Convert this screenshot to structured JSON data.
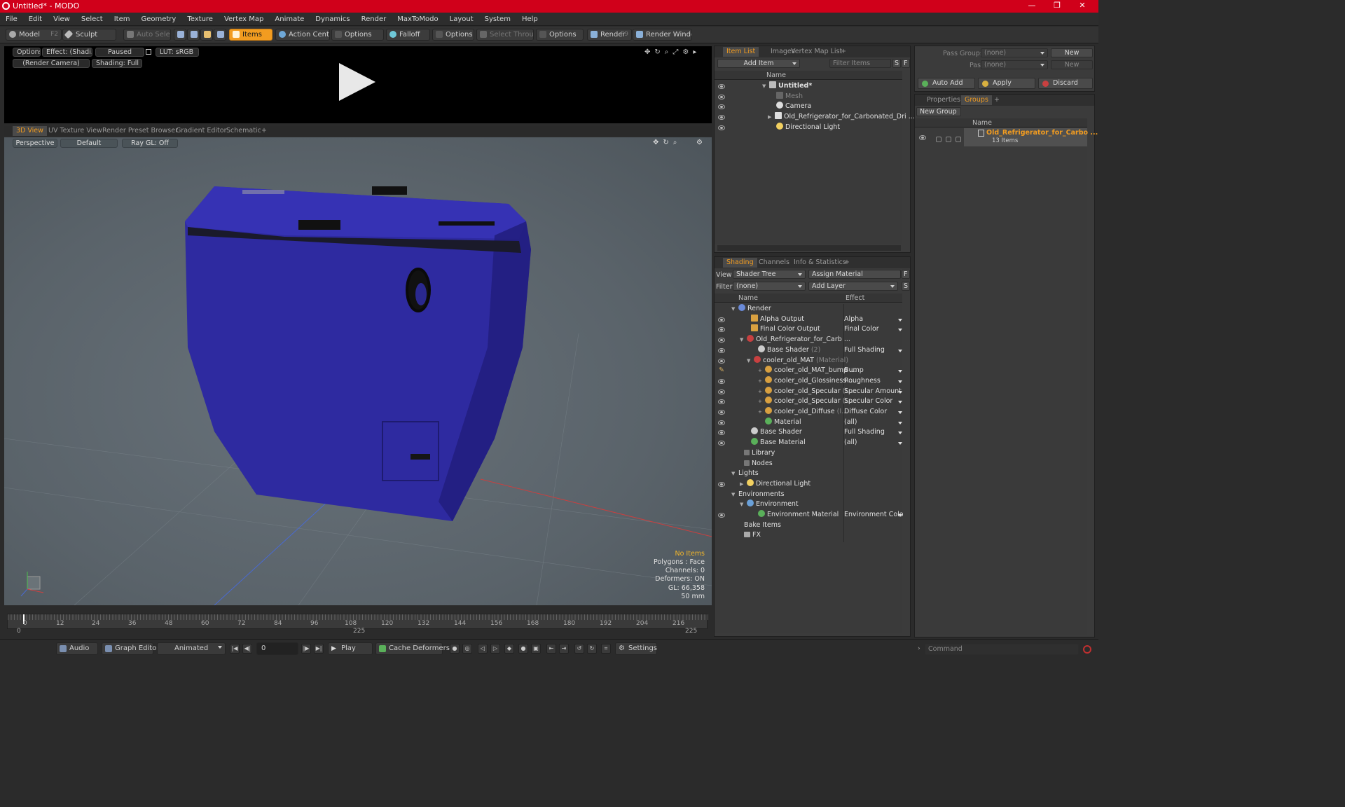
{
  "window": {
    "title": "Untitled* - MODO",
    "controls": [
      "—",
      "❐",
      "⧉",
      "✕"
    ]
  },
  "menu": [
    "File",
    "Edit",
    "View",
    "Select",
    "Item",
    "Geometry",
    "Texture",
    "Vertex Map",
    "Animate",
    "Dynamics",
    "Render",
    "MaxToModo",
    "Layout",
    "System",
    "Help"
  ],
  "toolbar": {
    "model": "Model",
    "model_key": "F2",
    "sculpt": "Sculpt",
    "auto_select": "Auto Select",
    "items": "Items",
    "action_center": "Action Center",
    "options1": "Options",
    "falloff": "Falloff",
    "options2": "Options",
    "select_through": "Select Through",
    "options3": "Options",
    "render": "Render",
    "render_key": "F9",
    "render_window": "Render Window"
  },
  "render_preview": {
    "options": "Options",
    "effect": "Effect: (Shadi...",
    "paused": "Paused",
    "lut": "LUT: sRGB",
    "camera": "(Render Camera)",
    "shading": "Shading: Full"
  },
  "viewport_tabs": [
    "3D View",
    "UV Texture View",
    "Render Preset Browser",
    "Gradient Editor",
    "Schematic",
    "+"
  ],
  "viewport": {
    "perspective": "Perspective",
    "default": "Default",
    "raygl": "Ray GL: Off",
    "hud": {
      "no_items": "No Items",
      "polygons": "Polygons : Face",
      "channels": "Channels: 0",
      "deformers": "Deformers: ON",
      "gl": "GL: 66,358",
      "focal": "50 mm"
    }
  },
  "timeline": {
    "ticks": [
      "0",
      "12",
      "24",
      "36",
      "48",
      "60",
      "72",
      "84",
      "96",
      "108",
      "120",
      "132",
      "144",
      "156",
      "168",
      "180",
      "192",
      "204",
      "216"
    ],
    "start": "0",
    "mid": "225",
    "end": "225"
  },
  "bottombar": {
    "audio": "Audio",
    "graph_editor": "Graph Editor",
    "animated": "Animated",
    "frame": "0",
    "play": "Play",
    "cache_deformers": "Cache Deformers",
    "settings": "Settings",
    "command_placeholder": "Command"
  },
  "item_list": {
    "tabs": [
      "Item List",
      "Images",
      "Vertex Map List",
      "+"
    ],
    "add_item": "Add Item",
    "filter_items": "Filter Items",
    "s": "S",
    "f": "F",
    "col_name": "Name",
    "rows": [
      {
        "label": "Untitled*",
        "depth": 0
      },
      {
        "label": "Mesh",
        "depth": 1
      },
      {
        "label": "Camera",
        "depth": 1
      },
      {
        "label": "Old_Refrigerator_for_Carbonated_Dri ...",
        "depth": 1
      },
      {
        "label": "Directional Light",
        "depth": 1
      }
    ]
  },
  "shading": {
    "tabs": [
      "Shading",
      "Channels",
      "Info & Statistics",
      "+"
    ],
    "view_label": "View",
    "view_value": "Shader Tree",
    "assign_material": "Assign Material",
    "filter_label": "Filter",
    "filter_value": "(none)",
    "add_layer": "Add Layer",
    "f": "F",
    "s": "S",
    "col_name": "Name",
    "col_effect": "Effect",
    "rows": [
      {
        "name": "Render",
        "effect": ""
      },
      {
        "name": "Alpha Output",
        "effect": "Alpha"
      },
      {
        "name": "Final Color Output",
        "effect": "Final Color"
      },
      {
        "name": "Old_Refrigerator_for_Carb ...",
        "effect": ""
      },
      {
        "name": "Base Shader",
        "suffix": "(2)",
        "effect": "Full Shading"
      },
      {
        "name": "cooler_old_MAT",
        "suffix": "(Material)",
        "effect": ""
      },
      {
        "name": "cooler_old_MAT_bump ...",
        "effect": "Bump"
      },
      {
        "name": "cooler_old_Glossiness ...",
        "effect": "Roughness"
      },
      {
        "name": "cooler_old_Specular",
        "suffix": "(I...",
        "effect": "Specular Amount"
      },
      {
        "name": "cooler_old_Specular",
        "suffix": "(I...",
        "effect": "Specular Color"
      },
      {
        "name": "cooler_old_Diffuse",
        "suffix": "(I...",
        "effect": "Diffuse Color"
      },
      {
        "name": "Material",
        "effect": "(all)"
      },
      {
        "name": "Base Shader",
        "effect": "Full Shading"
      },
      {
        "name": "Base Material",
        "effect": "(all)"
      },
      {
        "name": "Library",
        "effect": ""
      },
      {
        "name": "Nodes",
        "effect": ""
      },
      {
        "name": "Lights",
        "effect": ""
      },
      {
        "name": "Directional Light",
        "effect": ""
      },
      {
        "name": "Environments",
        "effect": ""
      },
      {
        "name": "Environment",
        "effect": ""
      },
      {
        "name": "Environment Material",
        "effect": "Environment Color"
      },
      {
        "name": "Bake Items",
        "effect": ""
      },
      {
        "name": "FX",
        "effect": ""
      }
    ]
  },
  "passes": {
    "pass_groups": "Pass Groups",
    "pass_groups_value": "(none)",
    "new": "New",
    "passes": "Passes",
    "passes_value": "(none)",
    "new2": "New",
    "auto_add": "Auto Add",
    "apply": "Apply",
    "discard": "Discard"
  },
  "groups": {
    "tabs": [
      "Properties",
      "Groups",
      "+"
    ],
    "new_group": "New Group",
    "col_name": "Name",
    "group_name": "Old_Refrigerator_for_Carbo ...",
    "group_count": "13 Items"
  },
  "colors": {
    "accent": "#f29c20",
    "title_bar": "#d0001a",
    "cooler": "#2e2aa0"
  }
}
